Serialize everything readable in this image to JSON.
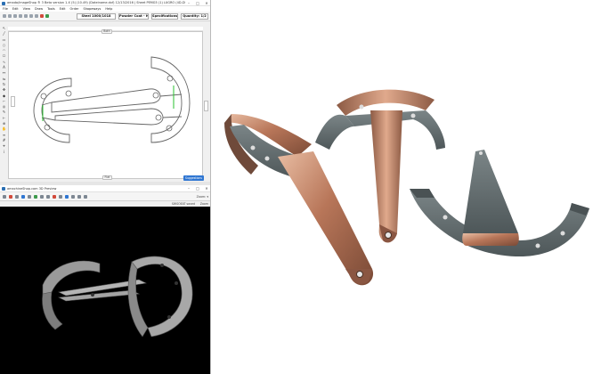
{
  "app": {
    "title": "amada/imageShop ® 3 Beta version 1.X (5) (10.49) (Dateiname.dxf) 12/13/2016 | Sheet PEMG5 (1) LUGRO (4D-DDB) - 1 pPROXQ...",
    "menu": [
      "File",
      "Edit",
      "View",
      "Draw",
      "Tools",
      "Edit",
      "Order",
      "Shapeways",
      "Help"
    ],
    "toolbar": {
      "steel_label": "Steel 1000/1018",
      "powder_label": "Powder Coat - HY ▾",
      "specs_label": "Specifications",
      "quantity_label": "Quantity: 1/2"
    },
    "canvas": {
      "top_tab": "Both",
      "bottom_tab": "Flat",
      "left_tab": "Left",
      "right_tab": "Right",
      "badge": "Suggestions"
    },
    "preview": {
      "title": "amachineShop.com 3D Preview",
      "zoom": "Zoom: ▾",
      "status": "SWSOEAT saved",
      "zoom_value": "Zoom"
    },
    "colors": {
      "accent": "#2f76d2",
      "bend_line": "#29c22f",
      "preview_bg": "#000000",
      "copper": "#c98a6a",
      "steel": "#5f6a6c"
    }
  }
}
